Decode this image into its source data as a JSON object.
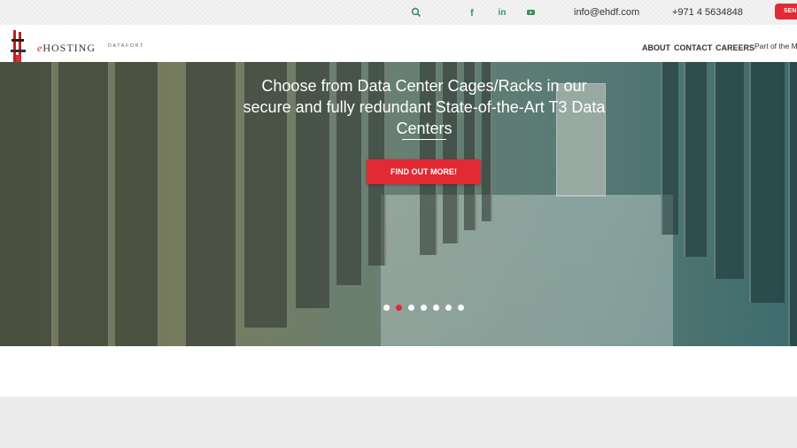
{
  "topbar": {
    "search_icon": "search-icon",
    "social": [
      "facebook-icon",
      "linkedin-icon",
      "youtube-icon"
    ],
    "email": "info@ehdf.com",
    "phone": "+971 4 5634848",
    "send_label": "SEN"
  },
  "brand": {
    "logo_prefix": "e",
    "logo_main": "HOSTING",
    "logo_sub": "DATAFORT"
  },
  "nav": {
    "items": [
      "ABOUT",
      "CONTACT",
      "CAREERS"
    ],
    "extra": "Part of the M"
  },
  "hero": {
    "headline": "Choose from Data Center Cages/Racks in our secure and fully redundant State-of-the-Art T3 Data Centers",
    "cta_label": "FIND OUT MORE!",
    "slides_total": 7,
    "active_slide": 2
  },
  "colors": {
    "accent": "#e12a34",
    "icon_green": "#3c8f63"
  }
}
